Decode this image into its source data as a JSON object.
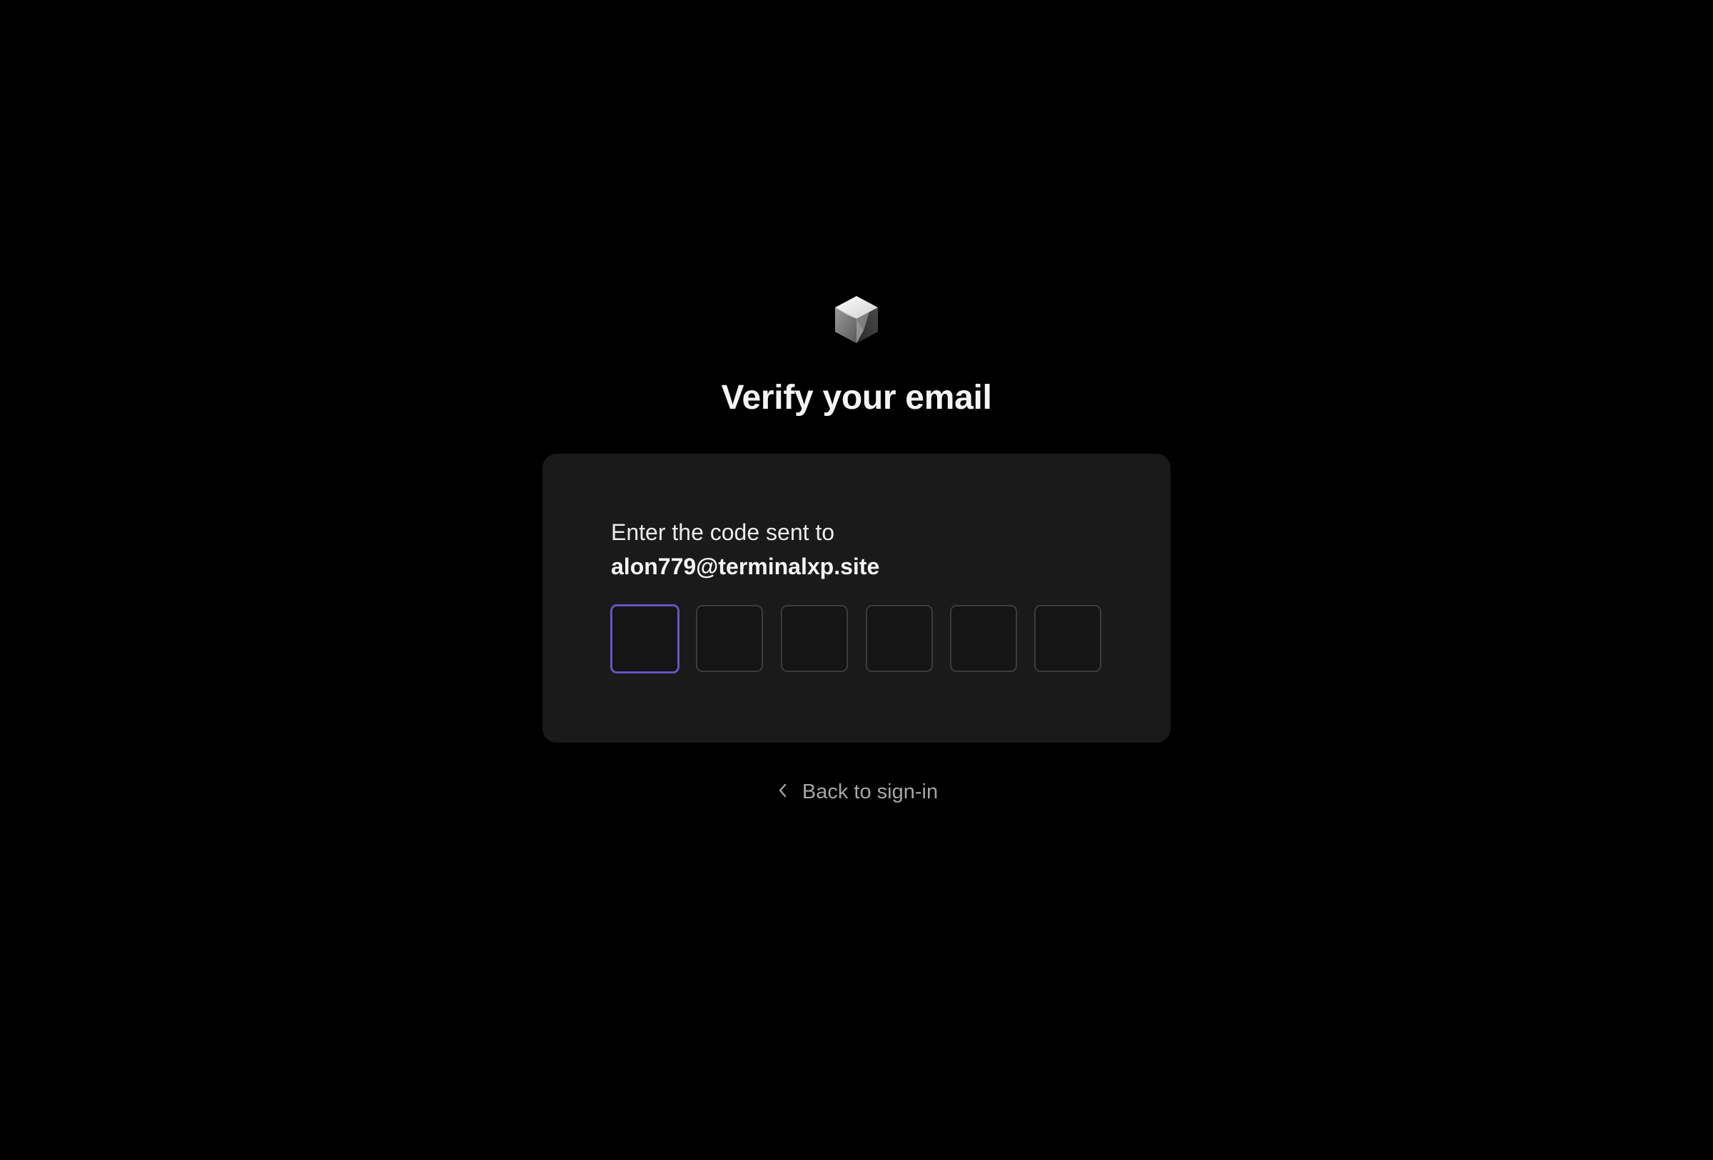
{
  "logo": {
    "icon": "cube-logo-icon"
  },
  "title": "Verify your email",
  "card": {
    "prompt_line1": "Enter the code sent to",
    "email": "alon779@terminalxp.site",
    "code_boxes": [
      {
        "value": "",
        "active": true
      },
      {
        "value": "",
        "active": false
      },
      {
        "value": "",
        "active": false
      },
      {
        "value": "",
        "active": false
      },
      {
        "value": "",
        "active": false
      },
      {
        "value": "",
        "active": false
      }
    ]
  },
  "back_link": {
    "label": "Back to sign-in",
    "icon": "chevron-left-icon"
  },
  "colors": {
    "background": "#000000",
    "card": "#1a1a1a",
    "focus_border": "#6456c4",
    "box_border": "#3c3c3c",
    "muted_text": "#a6a6a6"
  }
}
